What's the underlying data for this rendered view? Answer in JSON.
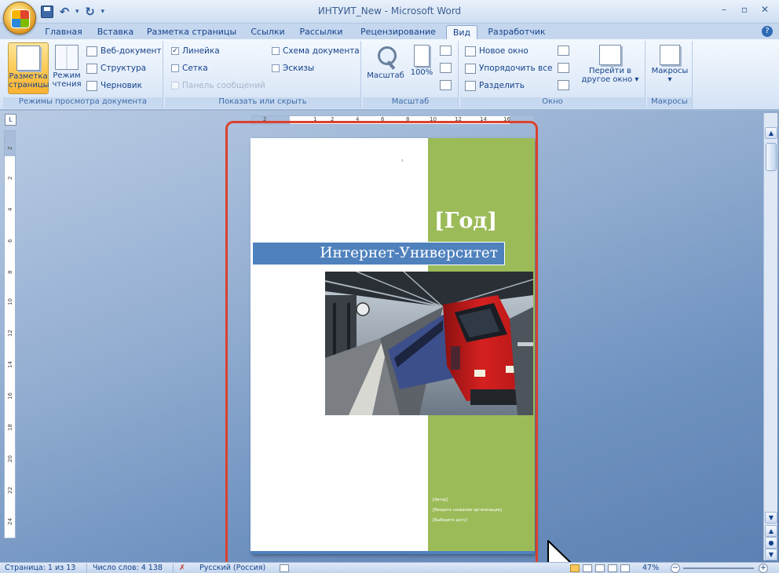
{
  "window": {
    "title": "ИНТУИТ_New - Microsoft Word",
    "controls": [
      "–",
      "▫",
      "✕"
    ]
  },
  "quick_access": {
    "undo_icon": "↶",
    "redo_icon": "↻",
    "dropdown": "▾"
  },
  "tabs": [
    {
      "label": "Главная",
      "active": false
    },
    {
      "label": "Вставка",
      "active": false
    },
    {
      "label": "Разметка страницы",
      "active": false
    },
    {
      "label": "Ссылки",
      "active": false
    },
    {
      "label": "Рассылки",
      "active": false
    },
    {
      "label": "Рецензирование",
      "active": false
    },
    {
      "label": "Вид",
      "active": true
    },
    {
      "label": "Разработчик",
      "active": false
    }
  ],
  "ribbon": {
    "doc_views": {
      "label": "Режимы просмотра документа",
      "print_layout_line1": "Разметка",
      "print_layout_line2": "страницы",
      "reading_line1": "Режим",
      "reading_line2": "чтения",
      "web": "Веб-документ",
      "outline": "Структура",
      "draft": "Черновик"
    },
    "show_hide": {
      "label": "Показать или скрыть",
      "ruler": "Линейка",
      "ruler_checked": "✓",
      "grid": "Сетка",
      "message_bar": "Панель сообщений",
      "doc_map": "Схема документа",
      "thumbnails": "Эскизы"
    },
    "zoom": {
      "label": "Масштаб",
      "zoom_btn": "Масштаб",
      "hundred": "100%"
    },
    "window": {
      "label": "Окно",
      "new_window": "Новое окно",
      "arrange_all": "Упорядочить все",
      "split": "Разделить",
      "switch_line1": "Перейти в",
      "switch_line2": "другое окно ▾"
    },
    "macros": {
      "label": "Макросы",
      "btn": "Макросы",
      "arrow": "▾"
    }
  },
  "ruler": {
    "corner": "L",
    "h_ticks": [
      "2",
      "1",
      "2",
      "4",
      "6",
      "8",
      "10",
      "12",
      "14",
      "16"
    ],
    "v_ticks": [
      "2",
      "2",
      "4",
      "6",
      "8",
      "10",
      "12",
      "14",
      "16",
      "18",
      "20",
      "22",
      "24"
    ]
  },
  "document": {
    "year": "[Год]",
    "title": "Интернет-Университет",
    "cursor_mark": "¹",
    "fields": [
      "[Автор]",
      "[Введите название организации]",
      "[Выберите дату]"
    ]
  },
  "scrollbar": {
    "up": "▲",
    "down": "▼",
    "prev": "▲",
    "browse": "●",
    "next": "▼"
  },
  "statusbar": {
    "page": "Страница: 1 из 13",
    "words": "Число слов: 4 138",
    "language": "Русский (Россия)",
    "zoom": "47%",
    "zoom_minus": "−",
    "zoom_plus": "+"
  },
  "colors": {
    "green_sidebar": "#9bbb59",
    "title_band": "#4f81bd",
    "highlight_frame": "#d9422f"
  },
  "icons": {
    "office_button": "office-logo",
    "mouse": "arrow-pointer"
  }
}
